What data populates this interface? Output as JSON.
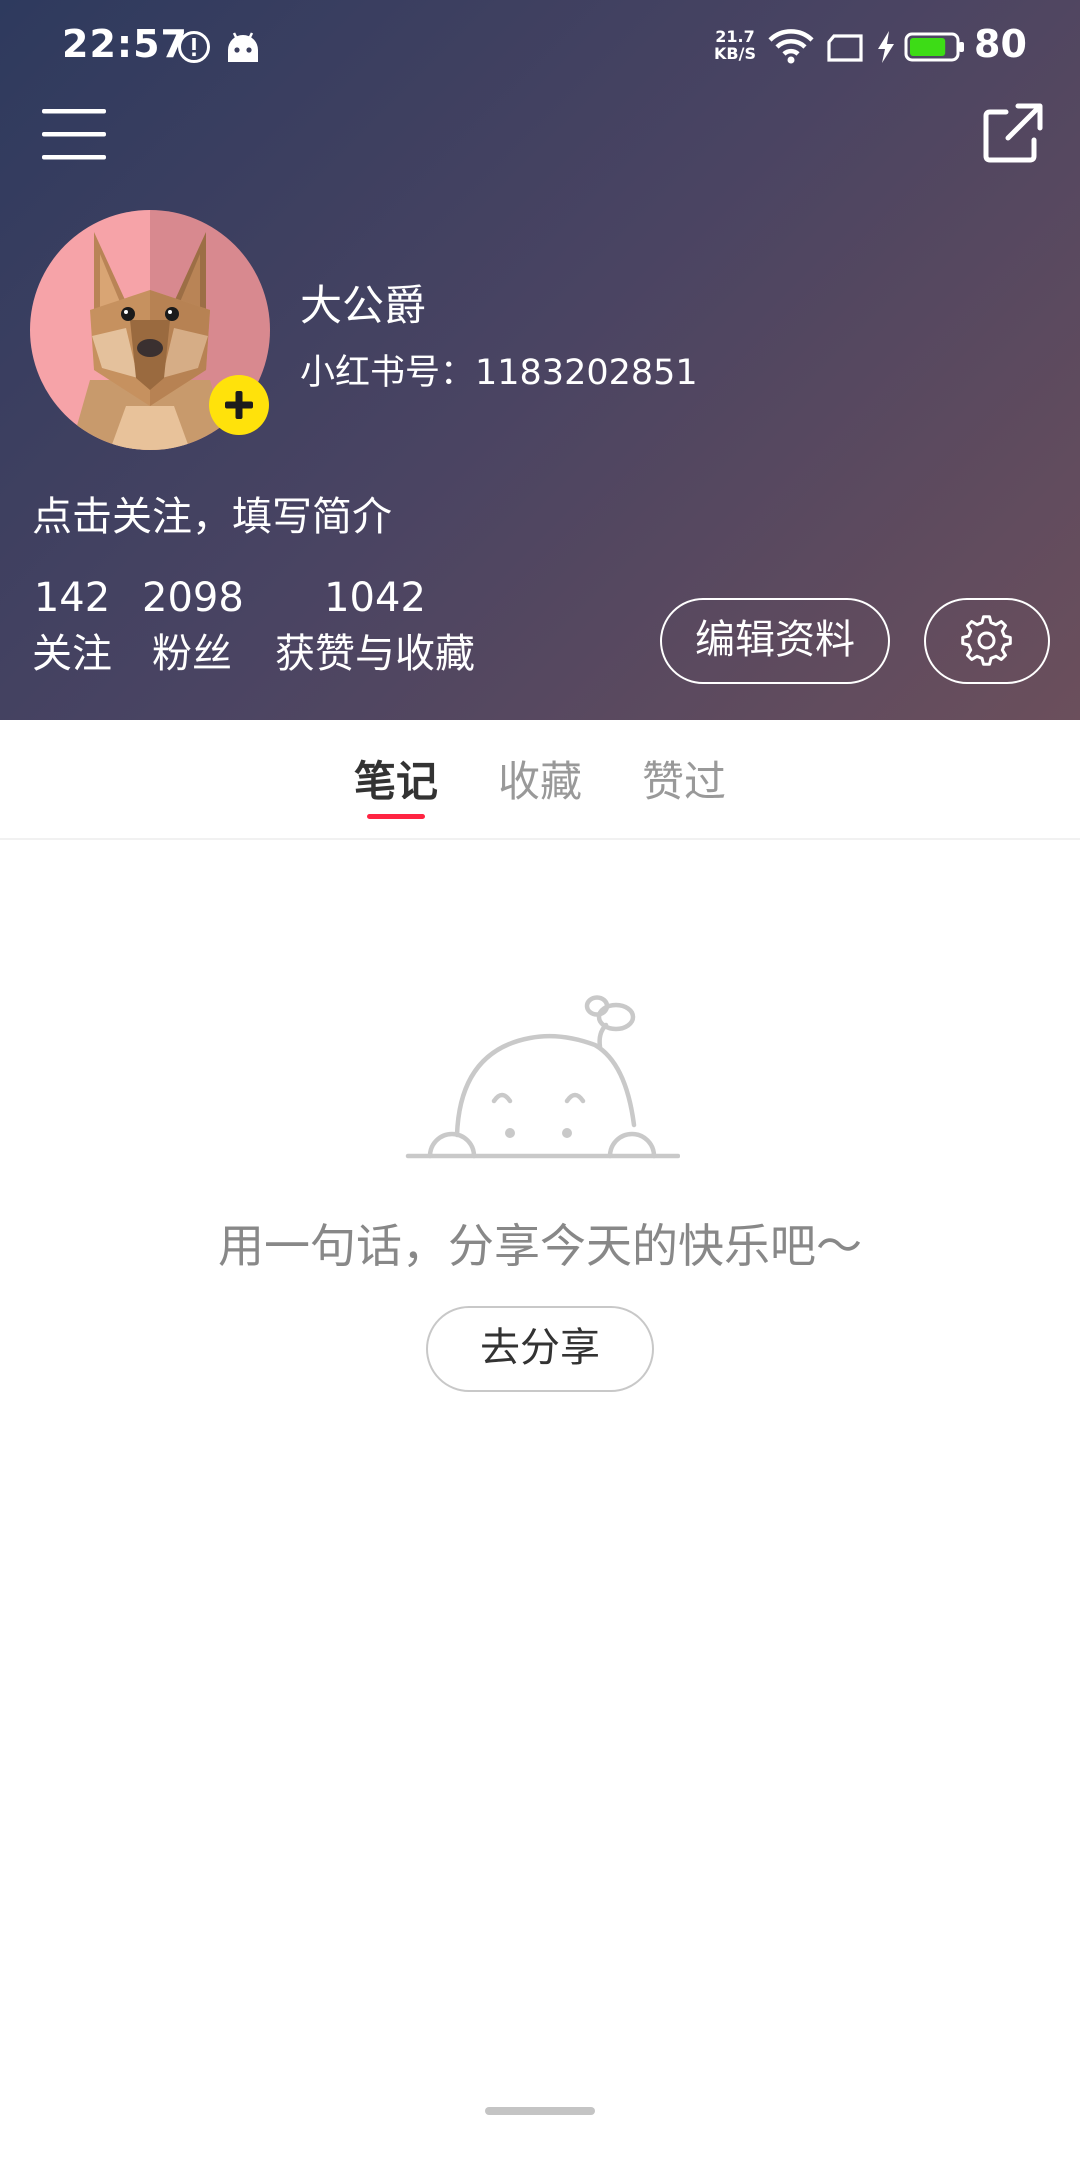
{
  "status_bar": {
    "time": "22:57",
    "net_speed_value": "21.7",
    "net_speed_unit": "KB/S",
    "battery_level": "80",
    "icons": [
      "alert-icon",
      "android-icon",
      "wifi-icon",
      "sim-icon",
      "charging-icon",
      "battery-icon"
    ],
    "battery_color": "#3ddc16"
  },
  "toolbar": {
    "menu_icon": "menu-icon",
    "share_icon": "share-icon"
  },
  "profile": {
    "name": "大公爵",
    "id_text": "小红书号：1183202851",
    "bio_prompt": "点击关注，填写简介",
    "avatar_icon": "dog-avatar",
    "add_icon": "plus-icon"
  },
  "stats": [
    {
      "value": "142",
      "label": "关注"
    },
    {
      "value": "2098",
      "label": "粉丝"
    },
    {
      "value": "1042",
      "label": "获赞与收藏"
    }
  ],
  "actions": {
    "edit_profile": "编辑资料",
    "settings_icon": "gear-icon"
  },
  "tabs": [
    {
      "label": "笔记",
      "active": true
    },
    {
      "label": "收藏",
      "active": false
    },
    {
      "label": "赞过",
      "active": false
    }
  ],
  "empty_state": {
    "illustration": "peeking-baby-illustration",
    "message": "用一句话，分享今天的快乐吧～",
    "cta": "去分享"
  },
  "colors": {
    "header_gradient_start": "#2e3a5e",
    "header_gradient_end": "#6b4f5c",
    "accent_red": "#ff2442",
    "add_badge_yellow": "#ffe20b"
  }
}
